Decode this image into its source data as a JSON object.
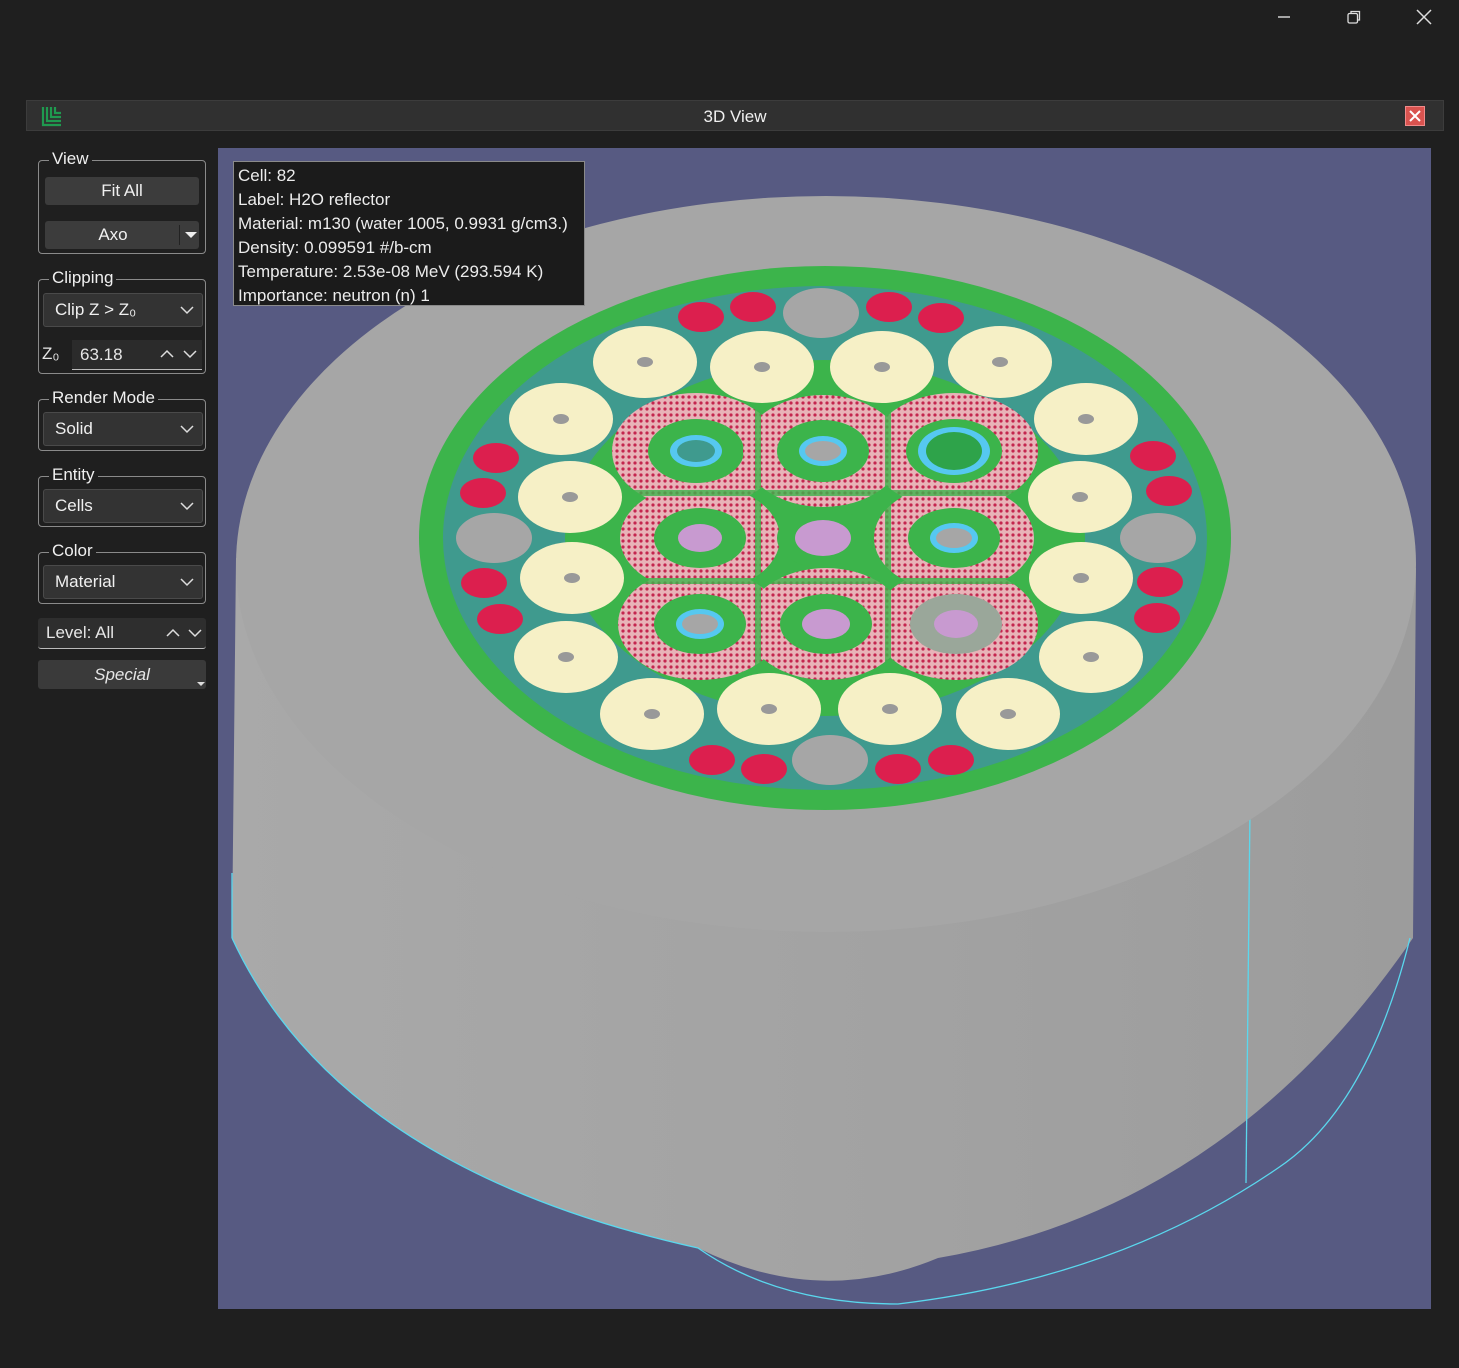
{
  "panel": {
    "title": "3D View"
  },
  "view_group": {
    "label": "View",
    "fit_all": "Fit All",
    "projection": "Axo"
  },
  "clipping_group": {
    "label": "Clipping",
    "mode": "Clip Z > Z₀",
    "z_label": "Z₀",
    "z_value": "63.18"
  },
  "render_group": {
    "label": "Render Mode",
    "mode": "Solid"
  },
  "entity_group": {
    "label": "Entity",
    "value": "Cells"
  },
  "color_group": {
    "label": "Color",
    "value": "Material"
  },
  "level": {
    "value": "Level: All"
  },
  "special": {
    "label": "Special"
  },
  "info": {
    "cell": "Cell: 82",
    "label": "Label: H2O reflector",
    "material": "Material: m130 (water 1005, 0.9931 g/cm3.)",
    "density": "Density: 0.099591 #/b-cm",
    "temperature": "Temperature: 2.53e-08 MeV (293.594 K)",
    "importance": "Importance: neutron (n) 1"
  },
  "colors": {
    "background": "#1f1f1f",
    "viewport": "#575a82",
    "reflector": "#a6a6a6",
    "core_ring": "#3cb44b",
    "core_base": "#3f9a8e",
    "fuel_disc": "#f6f0c6",
    "absorber": "#dc1f4e",
    "control": "#56c8f0"
  }
}
